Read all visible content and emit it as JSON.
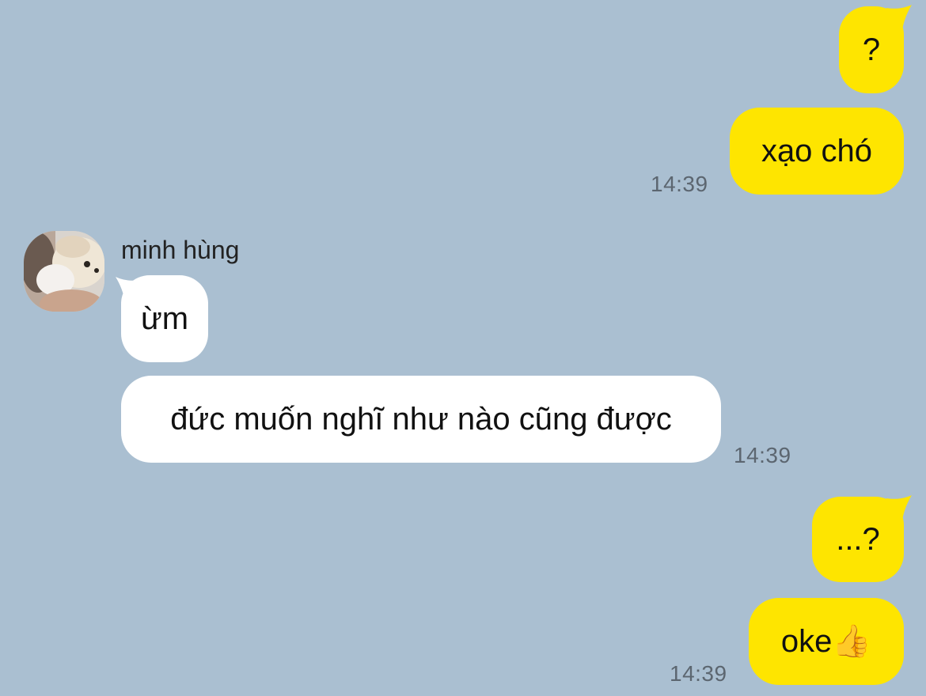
{
  "contact": {
    "name": "minh hùng",
    "avatar_icon": "dog-photo-avatar"
  },
  "messages": [
    {
      "side": "outgoing",
      "text": "?"
    },
    {
      "side": "outgoing",
      "text": "xạo chó",
      "time": "14:39"
    },
    {
      "side": "incoming",
      "text": "ừm"
    },
    {
      "side": "incoming",
      "text": "đức muốn nghĩ như nào cũng được",
      "time": "14:39"
    },
    {
      "side": "outgoing",
      "text": "...?"
    },
    {
      "side": "outgoing",
      "text": "oke👍",
      "time": "14:39"
    }
  ],
  "colors": {
    "background": "#aabfd1",
    "outgoing_bubble": "#fee500",
    "incoming_bubble": "#ffffff",
    "timestamp": "#5c6670"
  }
}
